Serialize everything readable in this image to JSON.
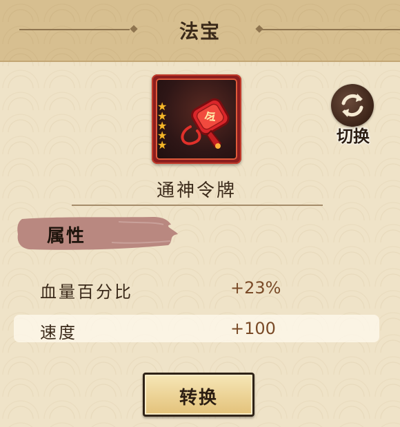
{
  "header": {
    "title": "法宝"
  },
  "item": {
    "icon": "token-icon",
    "star_count": 5,
    "name": "通神令牌"
  },
  "switch": {
    "label": "切换",
    "icon": "swap-arrows-icon"
  },
  "attributes": {
    "header_label": "属性",
    "rows": [
      {
        "name": "血量百分比",
        "value": "+23%"
      },
      {
        "name": "速度",
        "value": "+100"
      }
    ]
  },
  "actions": {
    "convert_label": "转换"
  },
  "colors": {
    "frame_red": "#8b1e1e",
    "star_gold": "#f5b72a",
    "brush": "#b98880",
    "value_text": "#7a4b28"
  }
}
